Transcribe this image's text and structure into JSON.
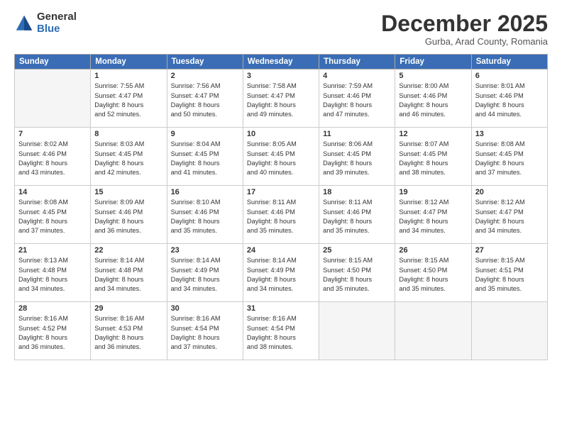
{
  "logo": {
    "general": "General",
    "blue": "Blue"
  },
  "header": {
    "month": "December 2025",
    "location": "Gurba, Arad County, Romania"
  },
  "days": [
    "Sunday",
    "Monday",
    "Tuesday",
    "Wednesday",
    "Thursday",
    "Friday",
    "Saturday"
  ],
  "weeks": [
    [
      {
        "day": "",
        "empty": true
      },
      {
        "day": "1",
        "sunrise": "Sunrise: 7:55 AM",
        "sunset": "Sunset: 4:47 PM",
        "daylight": "Daylight: 8 hours and 52 minutes."
      },
      {
        "day": "2",
        "sunrise": "Sunrise: 7:56 AM",
        "sunset": "Sunset: 4:47 PM",
        "daylight": "Daylight: 8 hours and 50 minutes."
      },
      {
        "day": "3",
        "sunrise": "Sunrise: 7:58 AM",
        "sunset": "Sunset: 4:47 PM",
        "daylight": "Daylight: 8 hours and 49 minutes."
      },
      {
        "day": "4",
        "sunrise": "Sunrise: 7:59 AM",
        "sunset": "Sunset: 4:46 PM",
        "daylight": "Daylight: 8 hours and 47 minutes."
      },
      {
        "day": "5",
        "sunrise": "Sunrise: 8:00 AM",
        "sunset": "Sunset: 4:46 PM",
        "daylight": "Daylight: 8 hours and 46 minutes."
      },
      {
        "day": "6",
        "sunrise": "Sunrise: 8:01 AM",
        "sunset": "Sunset: 4:46 PM",
        "daylight": "Daylight: 8 hours and 44 minutes."
      }
    ],
    [
      {
        "day": "7",
        "sunrise": "Sunrise: 8:02 AM",
        "sunset": "Sunset: 4:46 PM",
        "daylight": "Daylight: 8 hours and 43 minutes."
      },
      {
        "day": "8",
        "sunrise": "Sunrise: 8:03 AM",
        "sunset": "Sunset: 4:45 PM",
        "daylight": "Daylight: 8 hours and 42 minutes."
      },
      {
        "day": "9",
        "sunrise": "Sunrise: 8:04 AM",
        "sunset": "Sunset: 4:45 PM",
        "daylight": "Daylight: 8 hours and 41 minutes."
      },
      {
        "day": "10",
        "sunrise": "Sunrise: 8:05 AM",
        "sunset": "Sunset: 4:45 PM",
        "daylight": "Daylight: 8 hours and 40 minutes."
      },
      {
        "day": "11",
        "sunrise": "Sunrise: 8:06 AM",
        "sunset": "Sunset: 4:45 PM",
        "daylight": "Daylight: 8 hours and 39 minutes."
      },
      {
        "day": "12",
        "sunrise": "Sunrise: 8:07 AM",
        "sunset": "Sunset: 4:45 PM",
        "daylight": "Daylight: 8 hours and 38 minutes."
      },
      {
        "day": "13",
        "sunrise": "Sunrise: 8:08 AM",
        "sunset": "Sunset: 4:45 PM",
        "daylight": "Daylight: 8 hours and 37 minutes."
      }
    ],
    [
      {
        "day": "14",
        "sunrise": "Sunrise: 8:08 AM",
        "sunset": "Sunset: 4:45 PM",
        "daylight": "Daylight: 8 hours and 37 minutes."
      },
      {
        "day": "15",
        "sunrise": "Sunrise: 8:09 AM",
        "sunset": "Sunset: 4:46 PM",
        "daylight": "Daylight: 8 hours and 36 minutes."
      },
      {
        "day": "16",
        "sunrise": "Sunrise: 8:10 AM",
        "sunset": "Sunset: 4:46 PM",
        "daylight": "Daylight: 8 hours and 35 minutes."
      },
      {
        "day": "17",
        "sunrise": "Sunrise: 8:11 AM",
        "sunset": "Sunset: 4:46 PM",
        "daylight": "Daylight: 8 hours and 35 minutes."
      },
      {
        "day": "18",
        "sunrise": "Sunrise: 8:11 AM",
        "sunset": "Sunset: 4:46 PM",
        "daylight": "Daylight: 8 hours and 35 minutes."
      },
      {
        "day": "19",
        "sunrise": "Sunrise: 8:12 AM",
        "sunset": "Sunset: 4:47 PM",
        "daylight": "Daylight: 8 hours and 34 minutes."
      },
      {
        "day": "20",
        "sunrise": "Sunrise: 8:12 AM",
        "sunset": "Sunset: 4:47 PM",
        "daylight": "Daylight: 8 hours and 34 minutes."
      }
    ],
    [
      {
        "day": "21",
        "sunrise": "Sunrise: 8:13 AM",
        "sunset": "Sunset: 4:48 PM",
        "daylight": "Daylight: 8 hours and 34 minutes."
      },
      {
        "day": "22",
        "sunrise": "Sunrise: 8:14 AM",
        "sunset": "Sunset: 4:48 PM",
        "daylight": "Daylight: 8 hours and 34 minutes."
      },
      {
        "day": "23",
        "sunrise": "Sunrise: 8:14 AM",
        "sunset": "Sunset: 4:49 PM",
        "daylight": "Daylight: 8 hours and 34 minutes."
      },
      {
        "day": "24",
        "sunrise": "Sunrise: 8:14 AM",
        "sunset": "Sunset: 4:49 PM",
        "daylight": "Daylight: 8 hours and 34 minutes."
      },
      {
        "day": "25",
        "sunrise": "Sunrise: 8:15 AM",
        "sunset": "Sunset: 4:50 PM",
        "daylight": "Daylight: 8 hours and 35 minutes."
      },
      {
        "day": "26",
        "sunrise": "Sunrise: 8:15 AM",
        "sunset": "Sunset: 4:50 PM",
        "daylight": "Daylight: 8 hours and 35 minutes."
      },
      {
        "day": "27",
        "sunrise": "Sunrise: 8:15 AM",
        "sunset": "Sunset: 4:51 PM",
        "daylight": "Daylight: 8 hours and 35 minutes."
      }
    ],
    [
      {
        "day": "28",
        "sunrise": "Sunrise: 8:16 AM",
        "sunset": "Sunset: 4:52 PM",
        "daylight": "Daylight: 8 hours and 36 minutes."
      },
      {
        "day": "29",
        "sunrise": "Sunrise: 8:16 AM",
        "sunset": "Sunset: 4:53 PM",
        "daylight": "Daylight: 8 hours and 36 minutes."
      },
      {
        "day": "30",
        "sunrise": "Sunrise: 8:16 AM",
        "sunset": "Sunset: 4:54 PM",
        "daylight": "Daylight: 8 hours and 37 minutes."
      },
      {
        "day": "31",
        "sunrise": "Sunrise: 8:16 AM",
        "sunset": "Sunset: 4:54 PM",
        "daylight": "Daylight: 8 hours and 38 minutes."
      },
      {
        "day": "",
        "empty": true
      },
      {
        "day": "",
        "empty": true
      },
      {
        "day": "",
        "empty": true
      }
    ]
  ]
}
